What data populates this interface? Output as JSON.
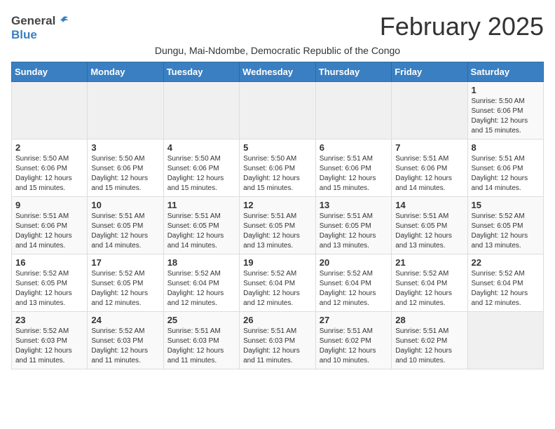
{
  "header": {
    "logo_general": "General",
    "logo_blue": "Blue",
    "month_year": "February 2025",
    "subtitle": "Dungu, Mai-Ndombe, Democratic Republic of the Congo"
  },
  "days_of_week": [
    "Sunday",
    "Monday",
    "Tuesday",
    "Wednesday",
    "Thursday",
    "Friday",
    "Saturday"
  ],
  "weeks": [
    [
      {
        "day": "",
        "info": ""
      },
      {
        "day": "",
        "info": ""
      },
      {
        "day": "",
        "info": ""
      },
      {
        "day": "",
        "info": ""
      },
      {
        "day": "",
        "info": ""
      },
      {
        "day": "",
        "info": ""
      },
      {
        "day": "1",
        "info": "Sunrise: 5:50 AM\nSunset: 6:06 PM\nDaylight: 12 hours and 15 minutes."
      }
    ],
    [
      {
        "day": "2",
        "info": "Sunrise: 5:50 AM\nSunset: 6:06 PM\nDaylight: 12 hours and 15 minutes."
      },
      {
        "day": "3",
        "info": "Sunrise: 5:50 AM\nSunset: 6:06 PM\nDaylight: 12 hours and 15 minutes."
      },
      {
        "day": "4",
        "info": "Sunrise: 5:50 AM\nSunset: 6:06 PM\nDaylight: 12 hours and 15 minutes."
      },
      {
        "day": "5",
        "info": "Sunrise: 5:50 AM\nSunset: 6:06 PM\nDaylight: 12 hours and 15 minutes."
      },
      {
        "day": "6",
        "info": "Sunrise: 5:51 AM\nSunset: 6:06 PM\nDaylight: 12 hours and 15 minutes."
      },
      {
        "day": "7",
        "info": "Sunrise: 5:51 AM\nSunset: 6:06 PM\nDaylight: 12 hours and 14 minutes."
      },
      {
        "day": "8",
        "info": "Sunrise: 5:51 AM\nSunset: 6:06 PM\nDaylight: 12 hours and 14 minutes."
      }
    ],
    [
      {
        "day": "9",
        "info": "Sunrise: 5:51 AM\nSunset: 6:06 PM\nDaylight: 12 hours and 14 minutes."
      },
      {
        "day": "10",
        "info": "Sunrise: 5:51 AM\nSunset: 6:05 PM\nDaylight: 12 hours and 14 minutes."
      },
      {
        "day": "11",
        "info": "Sunrise: 5:51 AM\nSunset: 6:05 PM\nDaylight: 12 hours and 14 minutes."
      },
      {
        "day": "12",
        "info": "Sunrise: 5:51 AM\nSunset: 6:05 PM\nDaylight: 12 hours and 13 minutes."
      },
      {
        "day": "13",
        "info": "Sunrise: 5:51 AM\nSunset: 6:05 PM\nDaylight: 12 hours and 13 minutes."
      },
      {
        "day": "14",
        "info": "Sunrise: 5:51 AM\nSunset: 6:05 PM\nDaylight: 12 hours and 13 minutes."
      },
      {
        "day": "15",
        "info": "Sunrise: 5:52 AM\nSunset: 6:05 PM\nDaylight: 12 hours and 13 minutes."
      }
    ],
    [
      {
        "day": "16",
        "info": "Sunrise: 5:52 AM\nSunset: 6:05 PM\nDaylight: 12 hours and 13 minutes."
      },
      {
        "day": "17",
        "info": "Sunrise: 5:52 AM\nSunset: 6:05 PM\nDaylight: 12 hours and 12 minutes."
      },
      {
        "day": "18",
        "info": "Sunrise: 5:52 AM\nSunset: 6:04 PM\nDaylight: 12 hours and 12 minutes."
      },
      {
        "day": "19",
        "info": "Sunrise: 5:52 AM\nSunset: 6:04 PM\nDaylight: 12 hours and 12 minutes."
      },
      {
        "day": "20",
        "info": "Sunrise: 5:52 AM\nSunset: 6:04 PM\nDaylight: 12 hours and 12 minutes."
      },
      {
        "day": "21",
        "info": "Sunrise: 5:52 AM\nSunset: 6:04 PM\nDaylight: 12 hours and 12 minutes."
      },
      {
        "day": "22",
        "info": "Sunrise: 5:52 AM\nSunset: 6:04 PM\nDaylight: 12 hours and 12 minutes."
      }
    ],
    [
      {
        "day": "23",
        "info": "Sunrise: 5:52 AM\nSunset: 6:03 PM\nDaylight: 12 hours and 11 minutes."
      },
      {
        "day": "24",
        "info": "Sunrise: 5:52 AM\nSunset: 6:03 PM\nDaylight: 12 hours and 11 minutes."
      },
      {
        "day": "25",
        "info": "Sunrise: 5:51 AM\nSunset: 6:03 PM\nDaylight: 12 hours and 11 minutes."
      },
      {
        "day": "26",
        "info": "Sunrise: 5:51 AM\nSunset: 6:03 PM\nDaylight: 12 hours and 11 minutes."
      },
      {
        "day": "27",
        "info": "Sunrise: 5:51 AM\nSunset: 6:02 PM\nDaylight: 12 hours and 10 minutes."
      },
      {
        "day": "28",
        "info": "Sunrise: 5:51 AM\nSunset: 6:02 PM\nDaylight: 12 hours and 10 minutes."
      },
      {
        "day": "",
        "info": ""
      }
    ]
  ]
}
